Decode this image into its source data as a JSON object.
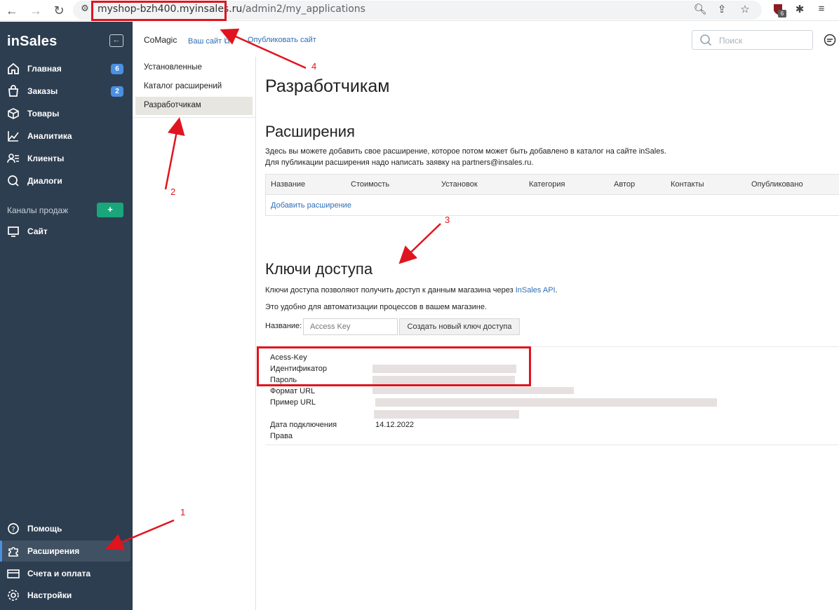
{
  "browser": {
    "url_host": "myshop-bzh400.myinsales.ru",
    "url_path": "/admin2/my_applications",
    "icons": [
      "back-arrow-icon",
      "forward-arrow-icon",
      "reload-icon",
      "site-info-icon",
      "zoom-icon",
      "share-icon",
      "star-icon",
      "extension-shield-icon",
      "puzzle-icon",
      "menu-icon"
    ],
    "extension_badge": "6"
  },
  "sidebar": {
    "logo": "inSales",
    "items": [
      {
        "label": "Главная",
        "badge": "6",
        "icon": "home-icon"
      },
      {
        "label": "Заказы",
        "badge": "2",
        "icon": "bag-icon"
      },
      {
        "label": "Товары",
        "icon": "box-icon"
      },
      {
        "label": "Аналитика",
        "icon": "chart-icon"
      },
      {
        "label": "Клиенты",
        "icon": "clients-icon"
      },
      {
        "label": "Диалоги",
        "icon": "dialog-icon"
      }
    ],
    "channels_label": "Каналы продаж",
    "channels_add": "+",
    "site_label": "Сайт",
    "bottom": [
      {
        "label": "Помощь",
        "icon": "help-icon"
      },
      {
        "label": "Расширения",
        "icon": "puzzle-icon"
      },
      {
        "label": "Счета и оплата",
        "icon": "card-icon"
      },
      {
        "label": "Настройки",
        "icon": "gear-icon"
      }
    ]
  },
  "topbar": {
    "app_name": "CoMagic",
    "your_site": "Ваш сайт",
    "publish": "Опубликовать сайт",
    "search_placeholder": "Поиск"
  },
  "submenu": {
    "items": [
      "Установленные",
      "Каталог расширений",
      "Разработчикам"
    ],
    "active": "Разработчикам"
  },
  "main": {
    "title": "Разработчикам",
    "extensions": {
      "title": "Расширения",
      "desc1": "Здесь вы можете добавить свое расширение, которое потом может быть добавлено в каталог на сайте inSales.",
      "desc2": "Для публикации расширения надо написать заявку на partners@insales.ru.",
      "columns": [
        "Название",
        "Стоимость",
        "Установок",
        "Категория",
        "Автор",
        "Контакты",
        "Опубликовано"
      ],
      "add_link": "Добавить расширение"
    },
    "keys": {
      "title": "Ключи доступа",
      "desc1_prefix": "Ключи доступа позволяют получить доступ к данным магазина через ",
      "desc1_link": "InSales API",
      "desc1_suffix": ".",
      "desc2": "Это удобно для автоматизации процессов в вашем магазине.",
      "name_label": "Название:",
      "name_placeholder": "Access Key",
      "create_button": "Создать новый ключ доступа",
      "key_name": "Acess-Key",
      "fields": {
        "identifier": "Идентификатор",
        "password": "Пароль",
        "format_url": "Формат URL",
        "example_url": "Пример URL",
        "connected": "Дата подключения",
        "connected_value": "14.12.2022",
        "rights": "Права"
      }
    }
  },
  "annotations": [
    "1",
    "2",
    "3",
    "4"
  ],
  "colors": {
    "sidebar": "#2d3e50",
    "accent": "#4a90e2",
    "green": "#1aa57a",
    "annotation": "#e0141e",
    "link": "#2f6fb5"
  }
}
